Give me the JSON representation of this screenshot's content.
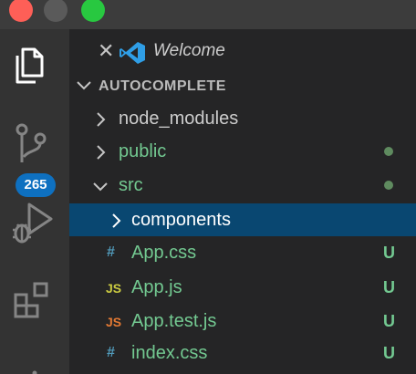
{
  "colors": {
    "titlebar": "#3c3c3c",
    "activitybar": "#333333",
    "sidebar": "#252526",
    "badge": "#0e70c0",
    "selected_row": "#094771",
    "git_untracked": "#73c991",
    "git_dot": "#5f8b5f",
    "css_icon": "#519aba",
    "js_icon": "#cbcb41",
    "test_icon": "#e37933"
  },
  "window_controls": [
    "close",
    "minimize",
    "maximize"
  ],
  "activity_bar": {
    "items": [
      {
        "icon": "files-icon"
      },
      {
        "icon": "source-control-icon",
        "badge": "265"
      },
      {
        "icon": "run-debug-icon"
      },
      {
        "icon": "extensions-icon"
      }
    ]
  },
  "open_editors": {
    "items": [
      {
        "label": "Welcome",
        "icon": "vscode-logo-icon"
      }
    ]
  },
  "explorer": {
    "folder_name": "AUTOCOMPLETE",
    "tree": [
      {
        "label": "node_modules",
        "type": "folder",
        "expanded": false
      },
      {
        "label": "public",
        "type": "folder",
        "expanded": false,
        "git": "dot"
      },
      {
        "label": "src",
        "type": "folder",
        "expanded": true,
        "git": "dot"
      },
      {
        "label": "components",
        "type": "folder",
        "expanded": false,
        "selected": true
      },
      {
        "label": "App.css",
        "type": "file",
        "file_icon": "#",
        "status": "U"
      },
      {
        "label": "App.js",
        "type": "file",
        "file_icon": "JS",
        "status": "U"
      },
      {
        "label": "App.test.js",
        "type": "file",
        "file_icon": "JS",
        "status": "U"
      },
      {
        "label": "index.css",
        "type": "file",
        "file_icon": "#",
        "status": "U"
      }
    ]
  }
}
